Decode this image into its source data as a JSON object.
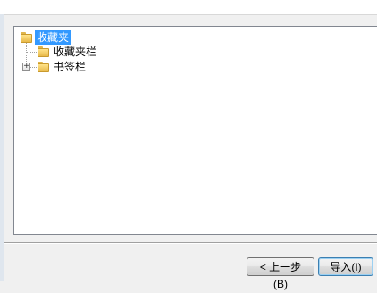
{
  "tree": {
    "root": {
      "label": "收藏夹",
      "icon": "folder-icon",
      "selected": true
    },
    "children": [
      {
        "label": "收藏夹栏",
        "icon": "folder-icon",
        "expandable": false
      },
      {
        "label": "书签栏",
        "icon": "folder-icon",
        "expandable": true,
        "expander_glyph": "+"
      }
    ]
  },
  "buttons": {
    "back": "< 上一步(B)",
    "import": "导入(I)"
  }
}
